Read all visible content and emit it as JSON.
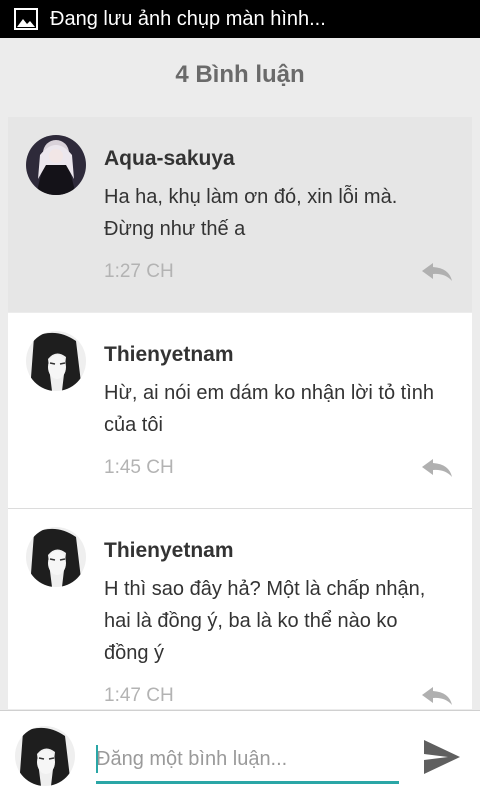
{
  "status_bar": {
    "text": "Đang lưu ảnh chụp màn hình...",
    "icon": "image-icon"
  },
  "header": {
    "title": "4 Bình luận"
  },
  "comments": [
    {
      "author": "Aqua-sakuya",
      "text": "Ha ha, khụ làm ơn đó, xin lỗi mà. Đừng như thế a",
      "time": "1:27 CH",
      "highlighted": true
    },
    {
      "author": "Thienyetnam",
      "text": "Hừ, ai nói em dám ko nhận lời tỏ tình của tôi",
      "time": "1:45 CH",
      "highlighted": false
    },
    {
      "author": "Thienyetnam",
      "text": "H thì sao đây hả? Một là chấp nhận, hai là đồng ý, ba là ko thể nào ko đồng ý",
      "time": "1:47 CH",
      "highlighted": false
    }
  ],
  "composer": {
    "placeholder": "Đăng một bình luận..."
  },
  "colors": {
    "accent": "#2aa6a6",
    "header_text": "#6a6a6a",
    "highlight_bg": "#e6e6e6"
  }
}
